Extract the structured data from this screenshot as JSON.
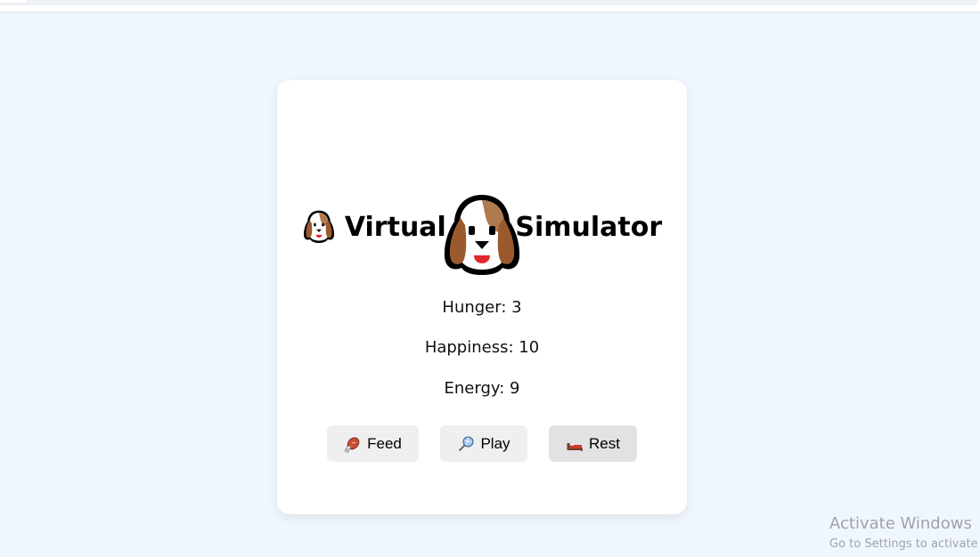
{
  "page": {
    "title": "Virtual Pet Simulator",
    "title_icon": "dog-face-icon",
    "pet_icon": "dog-face-icon"
  },
  "stats": {
    "hunger": "Hunger: 3",
    "happiness": "Happiness: 10",
    "energy": "Energy: 9"
  },
  "actions": {
    "feed": {
      "label": "Feed",
      "icon": "meat-on-bone-icon"
    },
    "play": {
      "label": "Play",
      "icon": "ball-icon"
    },
    "rest": {
      "label": "Rest",
      "icon": "bed-icon"
    }
  },
  "watermark": {
    "title": "Activate Windows",
    "subtitle": "Go to Settings to activate"
  },
  "colors": {
    "background": "#f0f6fd",
    "card": "#ffffff",
    "button": "#efefef",
    "button_hover": "#e2e2e2",
    "dog_brown": "#9b5a2e",
    "dog_tongue": "#e0282e"
  }
}
